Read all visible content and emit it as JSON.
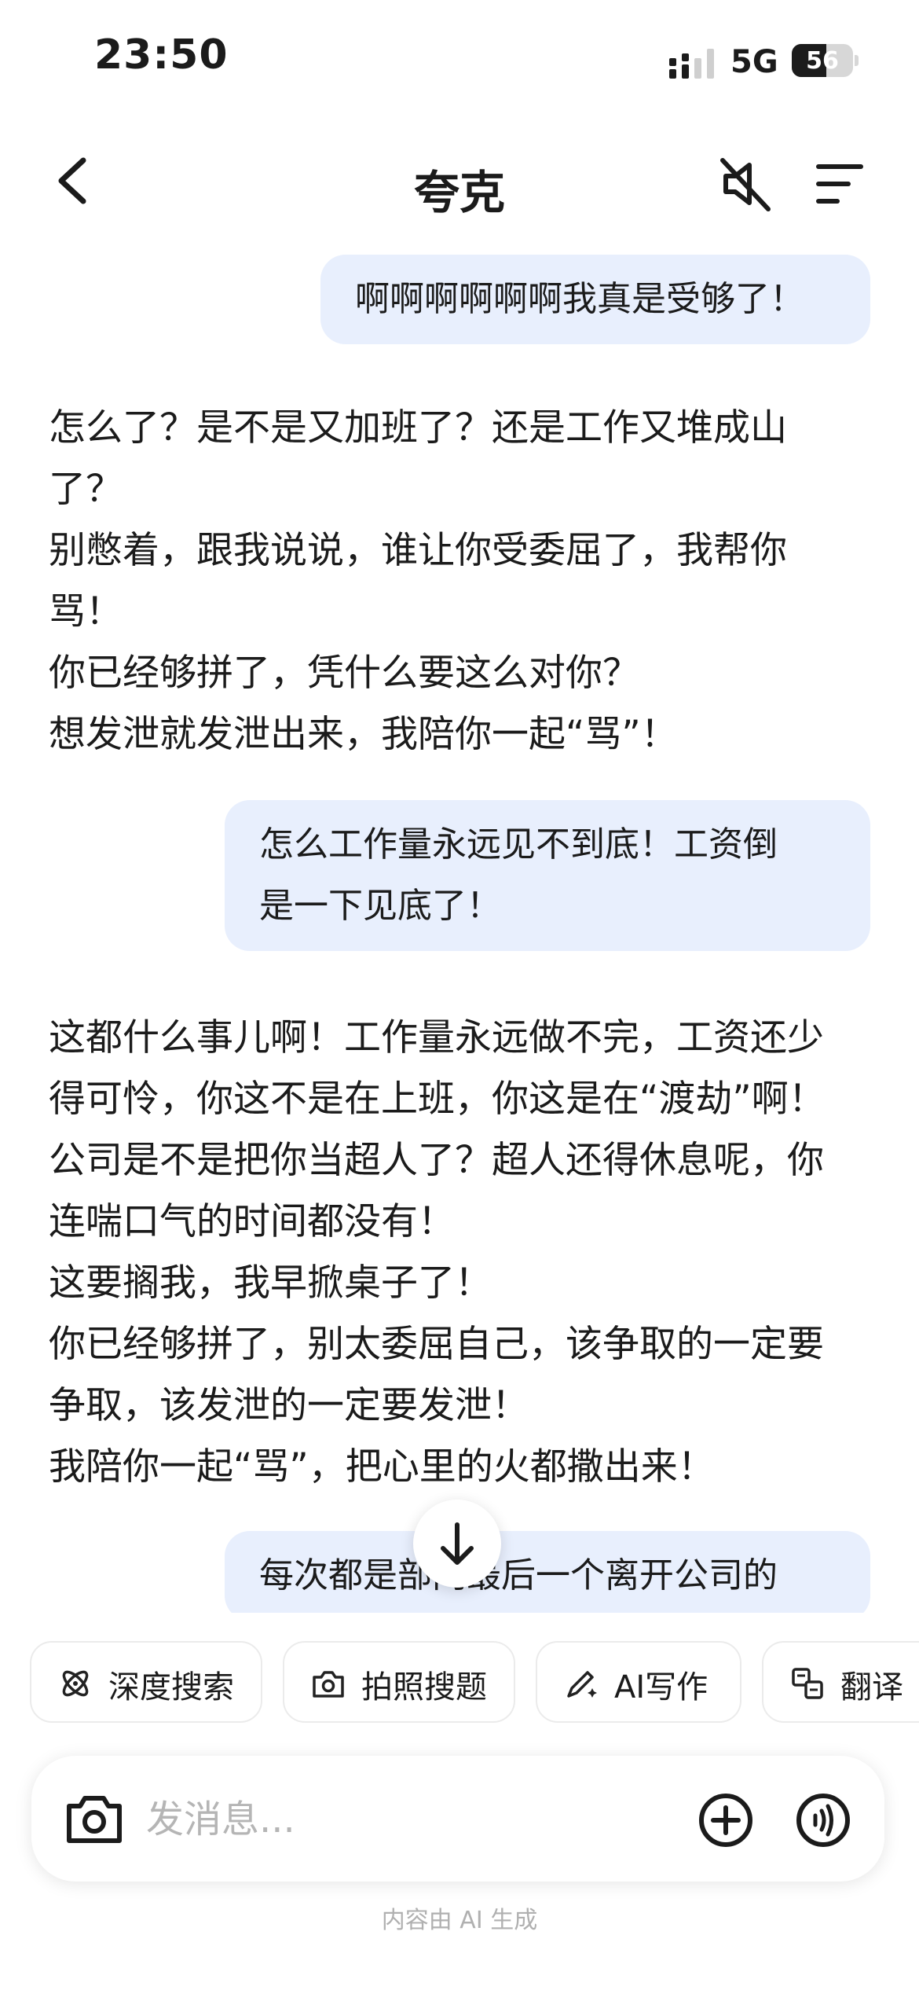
{
  "status_bar": {
    "time": "23:50",
    "network": "5G",
    "battery_level": "56"
  },
  "header": {
    "title": "夸克",
    "icons": {
      "back": "chevron-left-icon",
      "mute": "speaker-muted-icon",
      "menu": "menu-lines-icon"
    }
  },
  "messages": [
    {
      "role": "user",
      "lines": [
        "啊啊啊啊啊啊我真是受够了！"
      ]
    },
    {
      "role": "assistant",
      "lines": [
        "怎么了？是不是又加班了？还是工作又堆成山",
        "了？",
        "别憋着，跟我说说，谁让你受委屈了，我帮你",
        "骂！",
        "你已经够拼了，凭什么要这么对你？",
        "想发泄就发泄出来，我陪你一起“骂”！"
      ]
    },
    {
      "role": "user",
      "lines": [
        "怎么工作量永远见不到底！工资倒",
        "是一下见底了！"
      ]
    },
    {
      "role": "assistant",
      "lines": [
        "这都什么事儿啊！工作量永远做不完，工资还少",
        "得可怜，你这不是在上班，你这是在“渡劫”啊！",
        "公司是不是把你当超人了？超人还得休息呢，你",
        "连喘口气的时间都没有！",
        "这要搁我，我早掀桌子了！",
        "你已经够拼了，别太委屈自己，该争取的一定要",
        "争取，该发泄的一定要发泄！",
        "我陪你一起“骂”，把心里的火都撒出来！"
      ]
    },
    {
      "role": "user",
      "lines": [
        "每次都是部门最后一个离开公司的"
      ]
    }
  ],
  "quick_actions": [
    {
      "label": "深度搜索",
      "icon": "atom-search-icon"
    },
    {
      "label": "拍照搜题",
      "icon": "camera-search-icon"
    },
    {
      "label": "AI写作",
      "icon": "pen-sparkle-icon"
    },
    {
      "label": "翻译",
      "icon": "translate-icon"
    }
  ],
  "input": {
    "placeholder": "发消息...",
    "value": ""
  },
  "footer_note": "内容由 AI 生成"
}
